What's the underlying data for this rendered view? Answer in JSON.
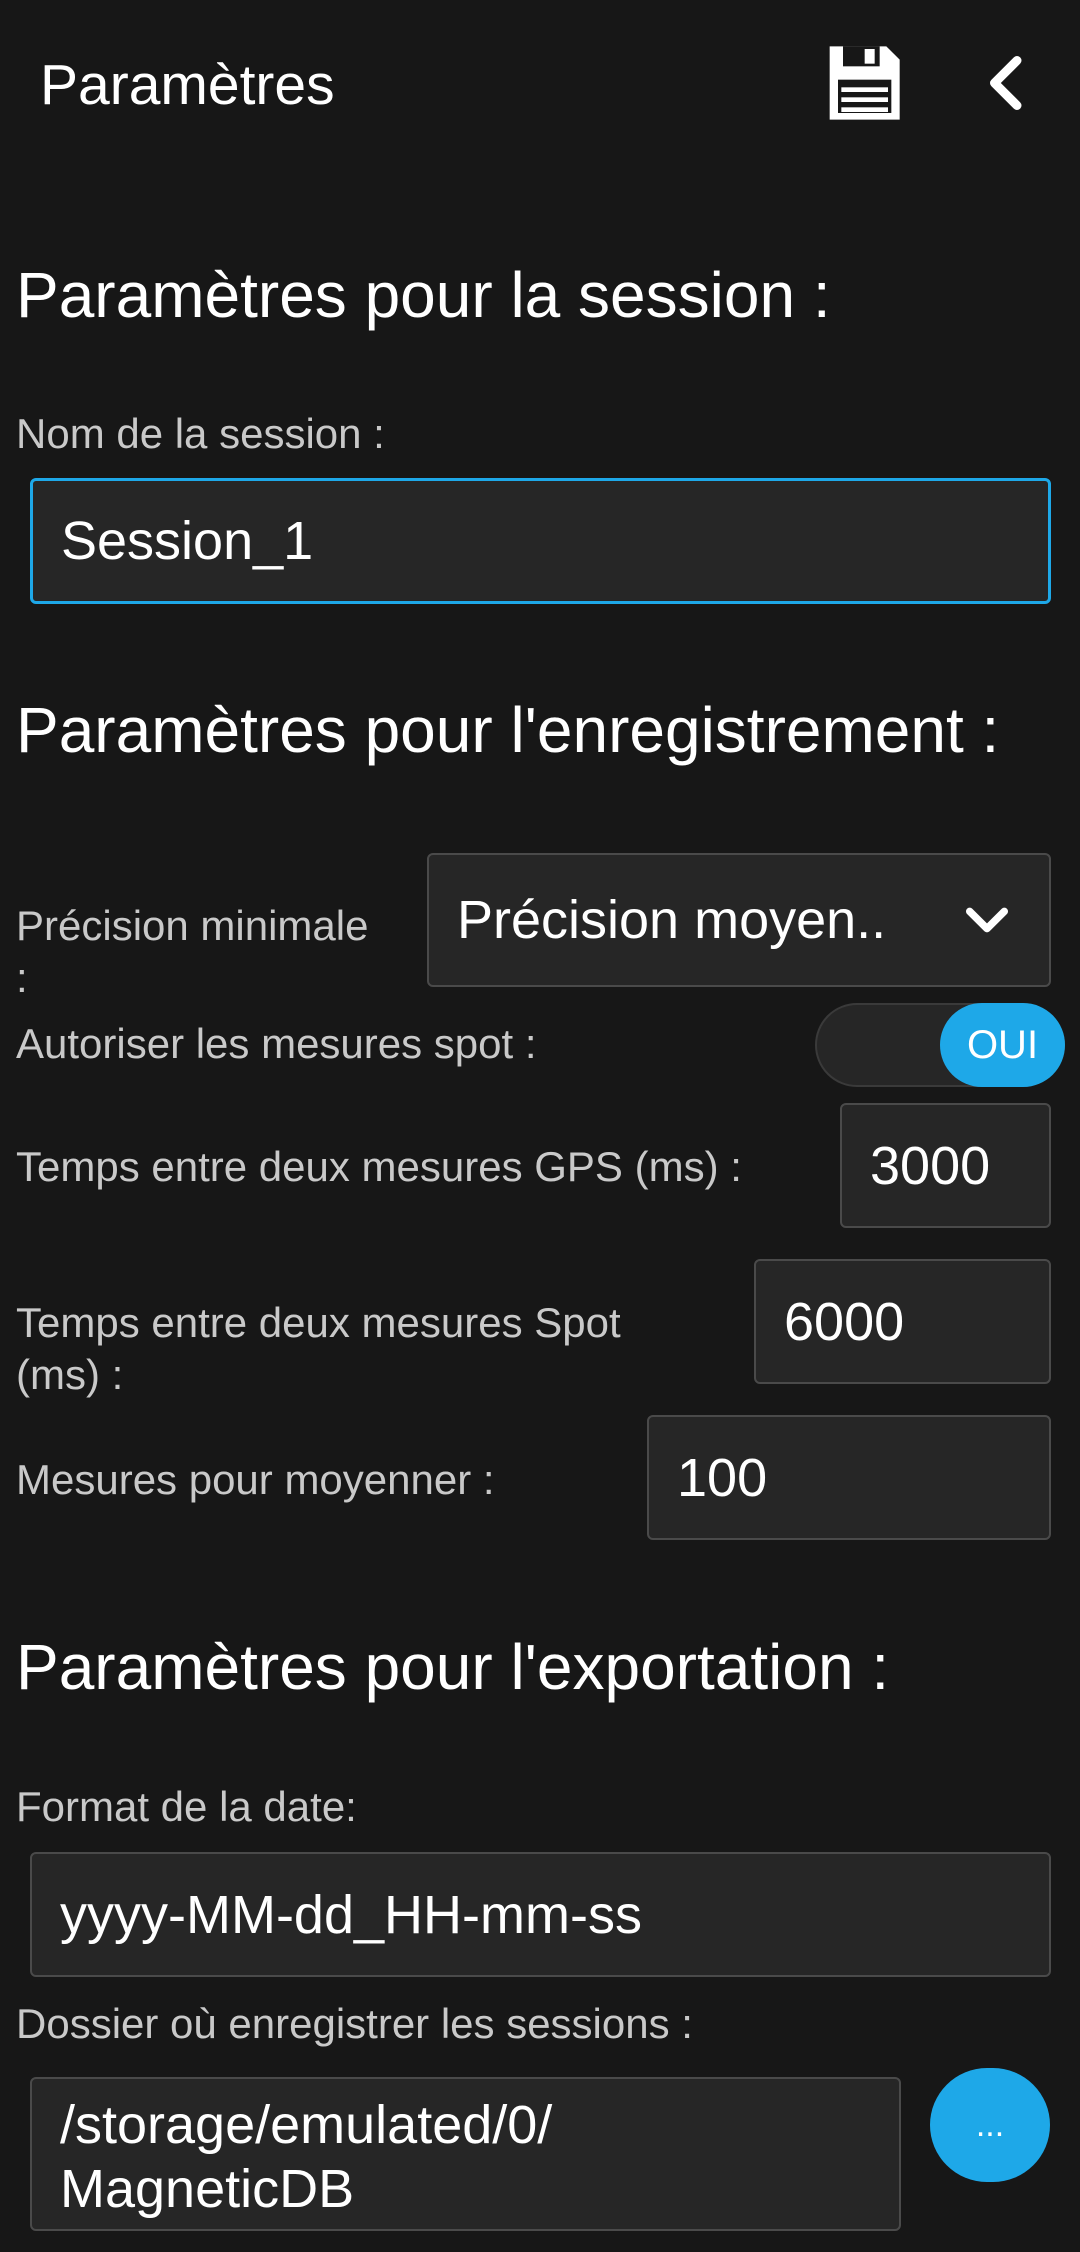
{
  "header": {
    "title": "Paramètres",
    "save_icon": "floppy-disk-icon",
    "back_icon": "chevron-left-icon"
  },
  "session": {
    "section_title": "Paramètres pour la session :",
    "name_label": "Nom de la session :",
    "name_value": "Session_1"
  },
  "recording": {
    "section_title": "Paramètres pour l'enregistrement :",
    "precision_label": "Précision minimale :",
    "precision_value": "Précision moyen..",
    "spot_label": "Autoriser les mesures spot :",
    "spot_toggle_label": "OUI",
    "spot_enabled": true,
    "gps_interval_label": "Temps entre deux mesures GPS (ms) :",
    "gps_interval_value": "3000",
    "spot_interval_label": "Temps entre deux mesures Spot (ms) :",
    "spot_interval_value": "6000",
    "average_label": "Mesures pour moyenner :",
    "average_value": "100"
  },
  "export": {
    "section_title": "Paramètres pour l'exportation :",
    "date_format_label": "Format de la date:",
    "date_format_value": "yyyy-MM-dd_HH-mm-ss",
    "folder_label": "Dossier où enregistrer les sessions :",
    "folder_value": "/storage/emulated/0/\nMagneticDB",
    "browse_label": "..."
  },
  "colors": {
    "background": "#171717",
    "accent": "#1ea8e8",
    "field_background": "#262626"
  }
}
